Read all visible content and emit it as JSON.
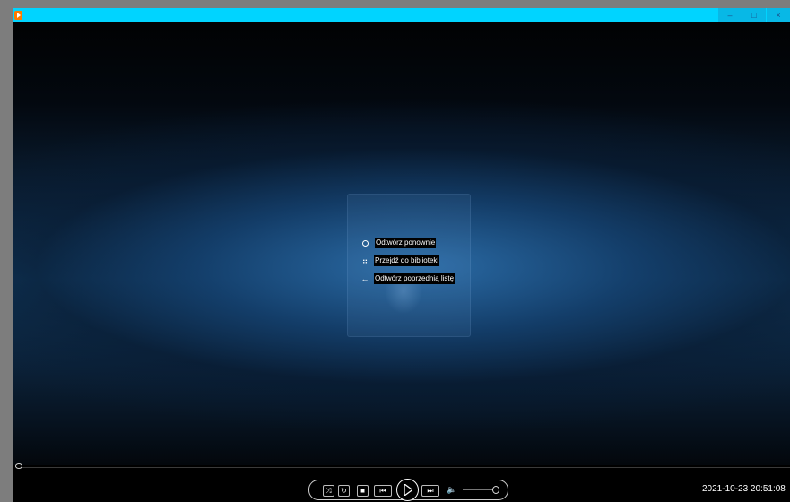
{
  "window": {
    "title": "",
    "controls": {
      "minimize": "–",
      "maximize": "□",
      "close": "×"
    }
  },
  "context_menu": {
    "items": [
      {
        "icon": "replay-icon",
        "label": "Odtwórz ponownie"
      },
      {
        "icon": "library-icon",
        "label": "Przejdź do biblioteki"
      },
      {
        "icon": "back-arrow-icon",
        "label": "Odtwórz poprzednią listę"
      }
    ]
  },
  "playback": {
    "position": 0,
    "volume": 1.0
  },
  "transport": {
    "shuffle": "⤨",
    "repeat": "↻",
    "stop": "■",
    "previous": "⏮",
    "next": "⏭",
    "mute": "🔈"
  },
  "taskbar": {
    "clock": "2021-10-23 20:51:08"
  },
  "colors": {
    "titlebar": "#00d4ff",
    "accent": "#2c6eaa"
  }
}
